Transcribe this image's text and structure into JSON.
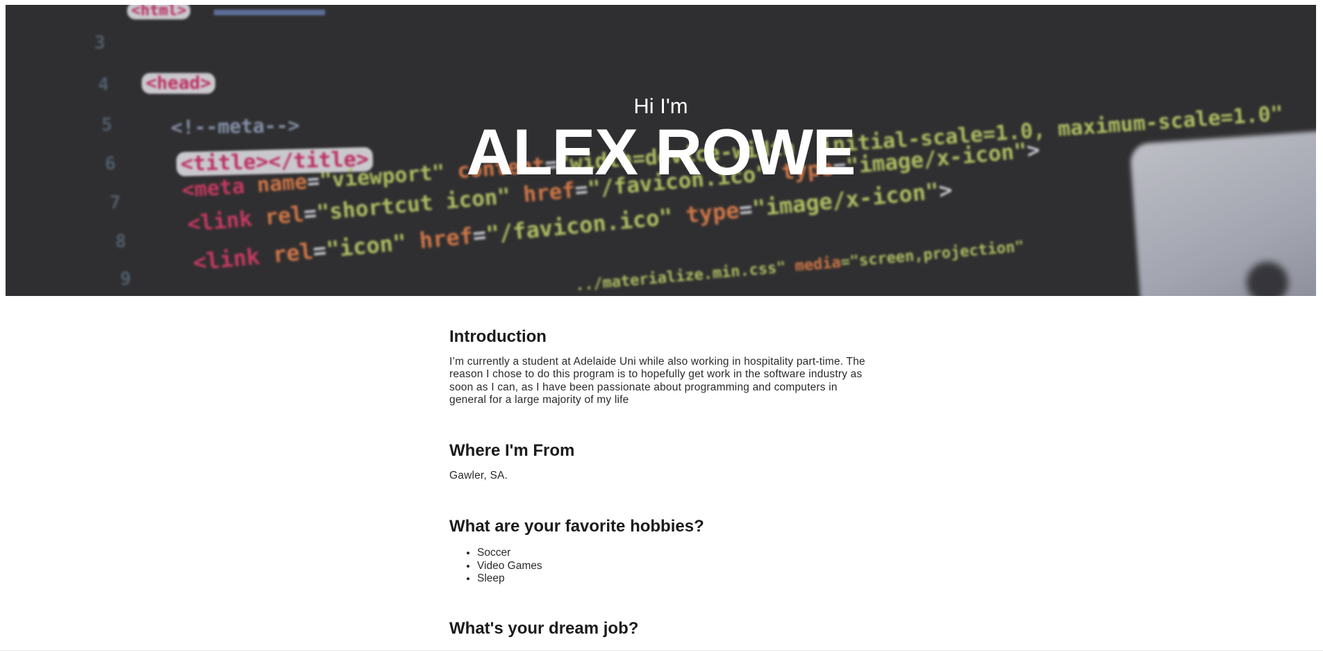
{
  "hero": {
    "greeting": "Hi I'm",
    "name": "ALEX ROWE",
    "background_color": "#333334"
  },
  "sections": {
    "introduction": {
      "title": "Introduction",
      "text": "I’m currently a student at Adelaide Uni while also working in hospitality part-time. The reason I chose to do this program is to hopefully get work in the software industry as soon as I can, as I have been passionate about programming and computers in general for a large majority of my life"
    },
    "origin": {
      "title": "Where I'm From",
      "text": "Gawler, SA."
    },
    "hobbies": {
      "title": "What are your favorite hobbies?",
      "items": [
        "Soccer",
        "Video Games",
        "Sleep"
      ]
    },
    "dream_job": {
      "title": "What's your dream job?"
    }
  }
}
